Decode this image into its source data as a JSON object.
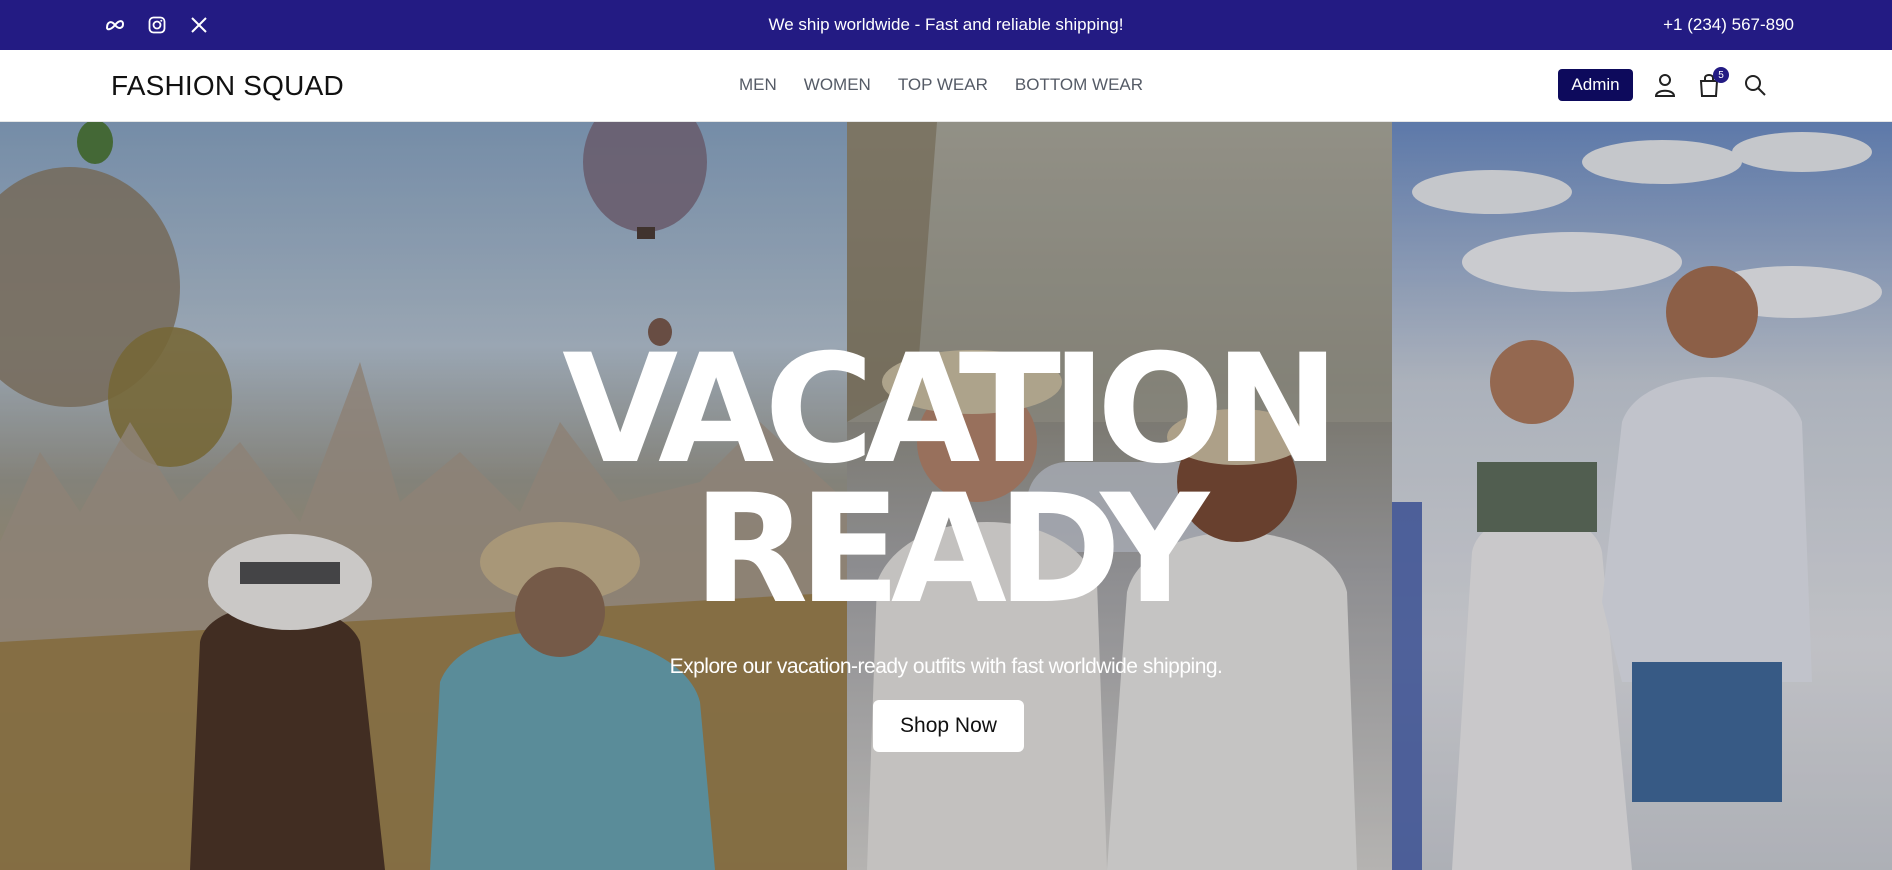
{
  "topbar": {
    "social_icons": [
      "meta-icon",
      "instagram-icon",
      "x-icon"
    ],
    "promo_text": "We ship worldwide - Fast and reliable shipping!",
    "phone": "+1 (234) 567-890",
    "bg_color": "#231b83"
  },
  "navbar": {
    "logo": "FASHION SQUAD",
    "menu": [
      "MEN",
      "WOMEN",
      "TOP WEAR",
      "BOTTOM WEAR"
    ],
    "admin_label": "Admin",
    "cart_count": "5",
    "icons": [
      "user-icon",
      "cart-icon",
      "search-icon"
    ]
  },
  "hero": {
    "headline_line1": "VACATION",
    "headline_line2": "READY",
    "subtitle": "Explore our vacation-ready outfits with fast worldwide shipping.",
    "cta_label": "Shop Now"
  }
}
